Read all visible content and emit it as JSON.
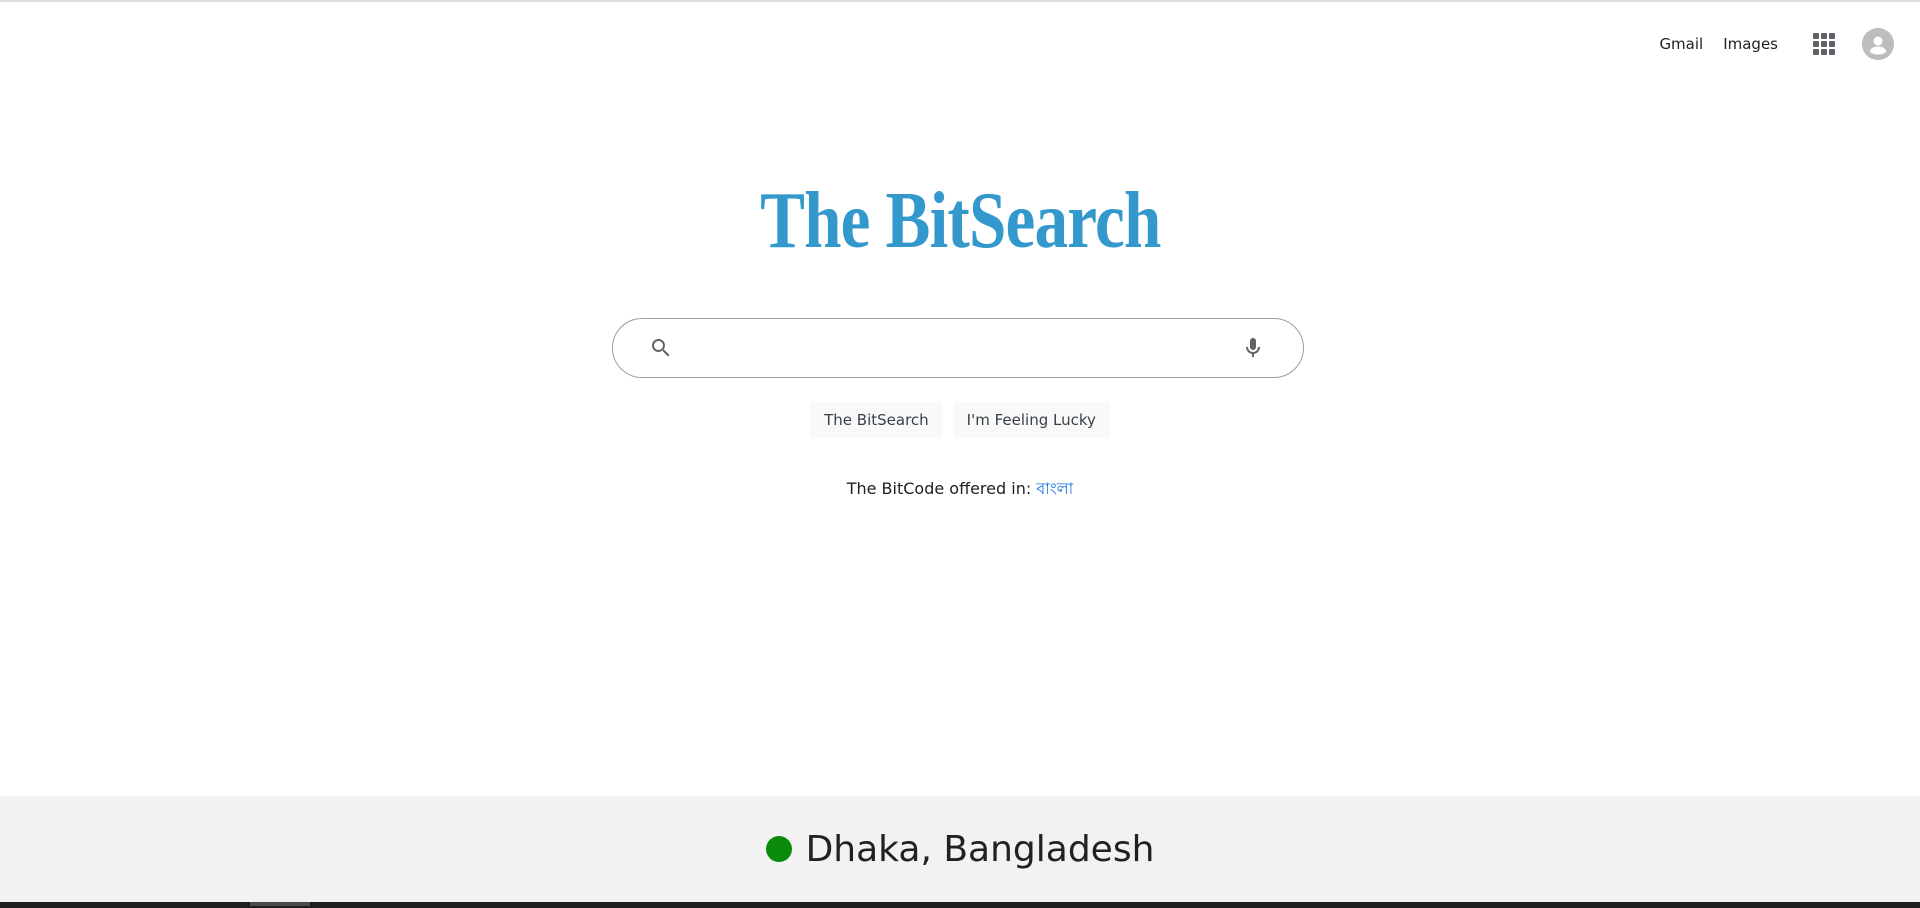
{
  "header": {
    "gmail_label": "Gmail",
    "images_label": "Images"
  },
  "logo": {
    "text": "The BitSearch",
    "color": "#3399cc"
  },
  "search": {
    "value": "",
    "placeholder": ""
  },
  "buttons": {
    "search_label": "The BitSearch",
    "lucky_label": "I'm Feeling Lucky"
  },
  "language_offer": {
    "prefix": "The BitCode offered in:",
    "language": "বাংলা"
  },
  "footer": {
    "location": "Dhaka, Bangladesh",
    "status_color": "#0a8a0a"
  },
  "icons": {
    "search": "search-icon",
    "mic": "mic-icon",
    "apps": "apps-grid-icon",
    "account": "account-icon"
  }
}
